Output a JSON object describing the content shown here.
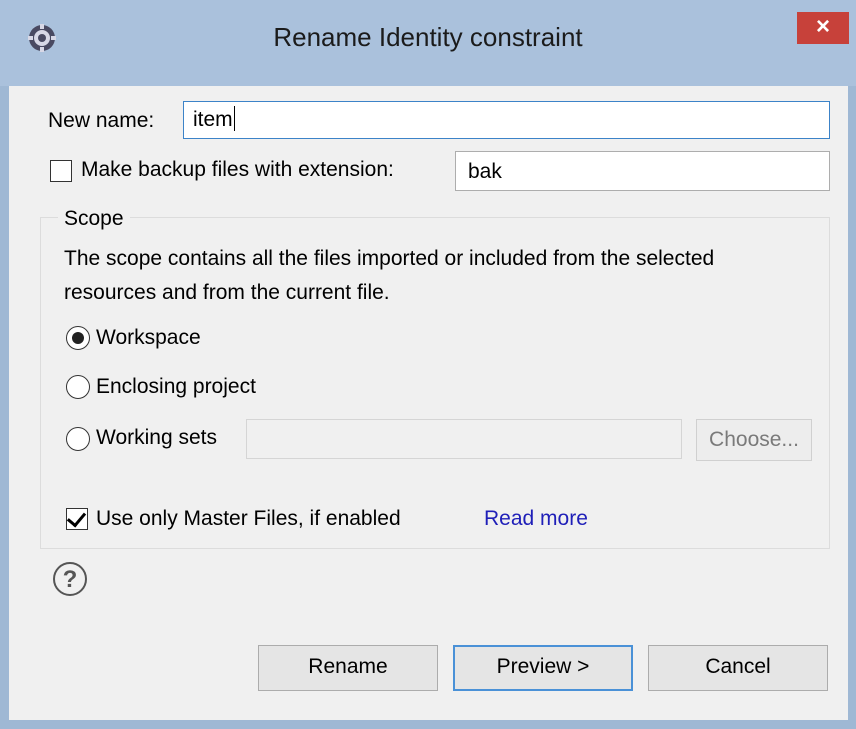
{
  "dialog": {
    "title": "Rename Identity constraint",
    "close_symbol": "×",
    "app_icon": "eclipse-gear-icon"
  },
  "form": {
    "new_name_label": "New name:",
    "new_name_value": "item",
    "backup_checkbox_label": "Make backup files with extension:",
    "backup_checked": false,
    "backup_extension": "bak"
  },
  "scope": {
    "title": "Scope",
    "description_line1": "The scope contains all the files imported or included from the selected",
    "description_line2": "resources and from the current file.",
    "options": [
      {
        "label": "Workspace",
        "selected": true
      },
      {
        "label": "Enclosing project",
        "selected": false
      },
      {
        "label": "Working sets",
        "selected": false
      }
    ],
    "working_sets_value": "",
    "choose_button": "Choose...",
    "master_files_label": "Use only Master Files, if enabled",
    "master_files_checked": true,
    "read_more_link": "Read more"
  },
  "footer": {
    "help_symbol": "?",
    "rename_button": "Rename",
    "preview_button": "Preview >",
    "cancel_button": "Cancel"
  },
  "colors": {
    "titlebar": "#aac1dc",
    "close": "#c7413a",
    "focus": "#3c83c8",
    "link": "#1f1fb8"
  }
}
